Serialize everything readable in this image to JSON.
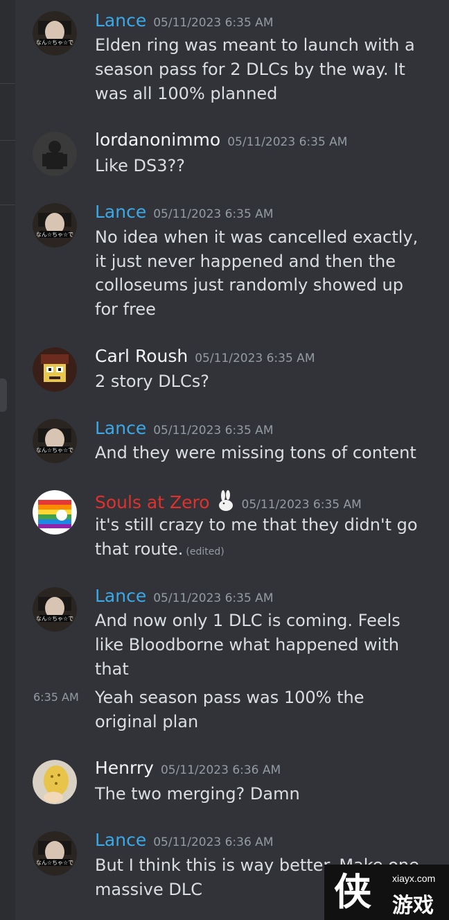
{
  "colors": {
    "background": "#313338",
    "text": "#dbdee1",
    "muted": "#949ba4",
    "lance": "#3ba8e8",
    "souls": "#e0312d",
    "default_name": "#f2f3f5"
  },
  "messages": [
    {
      "author": "Lance",
      "timestamp": "05/11/2023 6:35 AM",
      "lines": [
        "Elden ring was meant to launch with a",
        "season pass for 2 DLCs by the way. It",
        "was all 100% planned"
      ]
    },
    {
      "author": "lordanonimmo",
      "timestamp": "05/11/2023 6:35 AM",
      "lines": [
        "Like DS3??"
      ]
    },
    {
      "author": "Lance",
      "timestamp": "05/11/2023 6:35 AM",
      "lines": [
        "No idea when it was cancelled exactly,",
        "it just never happened and then the",
        "colloseums just randomly showed up",
        "for free"
      ]
    },
    {
      "author": "Carl Roush",
      "timestamp": "05/11/2023 6:35 AM",
      "lines": [
        "2 story DLCs?"
      ]
    },
    {
      "author": "Lance",
      "timestamp": "05/11/2023 6:35 AM",
      "lines": [
        "And they were missing tons of content"
      ]
    },
    {
      "author": "Souls at Zero",
      "timestamp": "05/11/2023 6:35 AM",
      "lines": [
        "it's still crazy to me that they didn't go",
        "that route."
      ],
      "edited": "(edited)",
      "badge_icon": "rabbit-icon"
    },
    {
      "author": "Lance",
      "timestamp": "05/11/2023 6:35 AM",
      "lines": [
        "And now only 1 DLC is coming. Feels",
        "like Bloodborne what happened with",
        "that"
      ],
      "followup": {
        "time": "6:35 AM",
        "lines": [
          "Yeah season pass was 100% the",
          "original plan"
        ]
      }
    },
    {
      "author": "Henrry",
      "timestamp": "05/11/2023 6:36 AM",
      "lines": [
        "The two merging? Damn"
      ]
    },
    {
      "author": "Lance",
      "timestamp": "05/11/2023 6:36 AM",
      "lines": [
        "But I think this is way better. Make one",
        "massive DLC"
      ]
    }
  ],
  "watermark": {
    "domain": "xiayx.com",
    "cn": "游戏",
    "logo": "侠"
  }
}
